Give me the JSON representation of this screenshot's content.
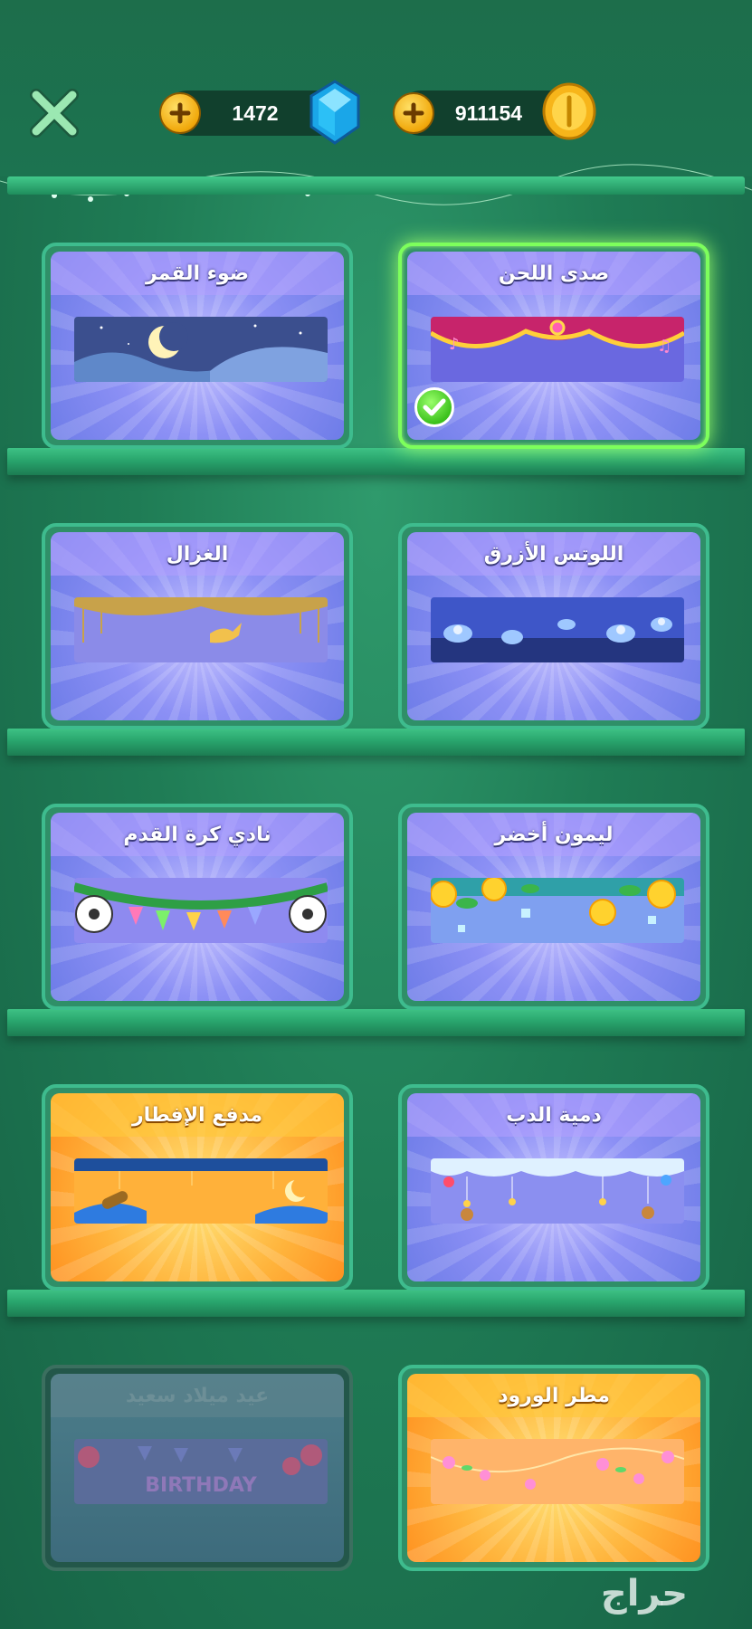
{
  "header": {
    "gems": {
      "value": "1472",
      "icon": "gem-icon"
    },
    "coins": {
      "value": "911154",
      "icon": "coin-icon"
    }
  },
  "cards": [
    {
      "title": "صدى اللحن",
      "theme": "purple",
      "selected": true,
      "locked": false,
      "banner": "curtain-banner"
    },
    {
      "title": "ضوء القمر",
      "theme": "purple",
      "selected": false,
      "locked": false,
      "banner": "moon-banner"
    },
    {
      "title": "اللوتس الأزرق",
      "theme": "purple",
      "selected": false,
      "locked": false,
      "banner": "lotus-banner"
    },
    {
      "title": "الغزال",
      "theme": "purple",
      "selected": false,
      "locked": false,
      "banner": "deer-banner"
    },
    {
      "title": "ليمون أخضر",
      "theme": "purple",
      "selected": false,
      "locked": false,
      "banner": "lemon-banner"
    },
    {
      "title": "نادي كرة القدم",
      "theme": "purple",
      "selected": false,
      "locked": false,
      "banner": "football-banner"
    },
    {
      "title": "دمية الدب",
      "theme": "purple",
      "selected": false,
      "locked": false,
      "banner": "teddy-banner"
    },
    {
      "title": "مدفع الإفطار",
      "theme": "orange",
      "selected": false,
      "locked": false,
      "banner": "cannon-banner"
    },
    {
      "title": "مطر الورود",
      "theme": "orange",
      "selected": false,
      "locked": false,
      "banner": "roses-banner"
    },
    {
      "title": "عيد ميلاد سعيد",
      "theme": "locked",
      "selected": false,
      "locked": true,
      "banner": "birthday-banner",
      "banner_text": "BIRTHDAY"
    }
  ],
  "watermark": "حراج",
  "colors": {
    "background": "#1f7c55",
    "shelf": "#29a56d",
    "card_border": "#3ebc8e",
    "selected_glow": "#7dff5c"
  }
}
